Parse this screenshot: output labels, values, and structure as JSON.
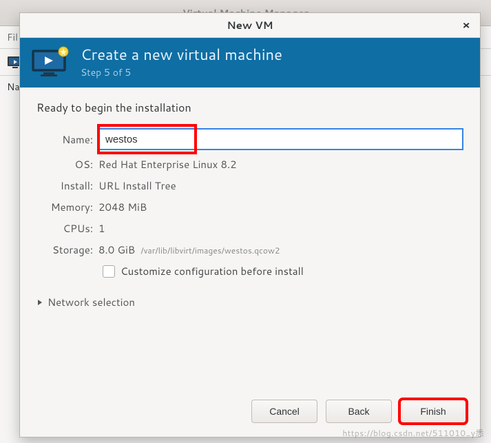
{
  "background": {
    "title": "Virtual Machine Manager",
    "menu_file": "Fil",
    "col_name": "Na"
  },
  "dialog": {
    "title": "New VM",
    "close_glyph": "×",
    "banner_title": "Create a new virtual machine",
    "banner_step": "Step 5 of 5",
    "ready_text": "Ready to begin the installation",
    "labels": {
      "name": "Name:",
      "os": "OS:",
      "install": "Install:",
      "memory": "Memory:",
      "cpus": "CPUs:",
      "storage": "Storage:"
    },
    "values": {
      "name": "westos",
      "os": "Red Hat Enterprise Linux 8.2",
      "install": "URL Install Tree",
      "memory": "2048 MiB",
      "cpus": "1",
      "storage": "8.0 GiB",
      "storage_path": "/var/lib/libvirt/images/westos.qcow2"
    },
    "customize_label": "Customize configuration before install",
    "network_label": "Network selection",
    "buttons": {
      "cancel": "Cancel",
      "back": "Back",
      "finish": "Finish"
    }
  },
  "watermark": "https://blog.csdn.net/511010_y悉"
}
